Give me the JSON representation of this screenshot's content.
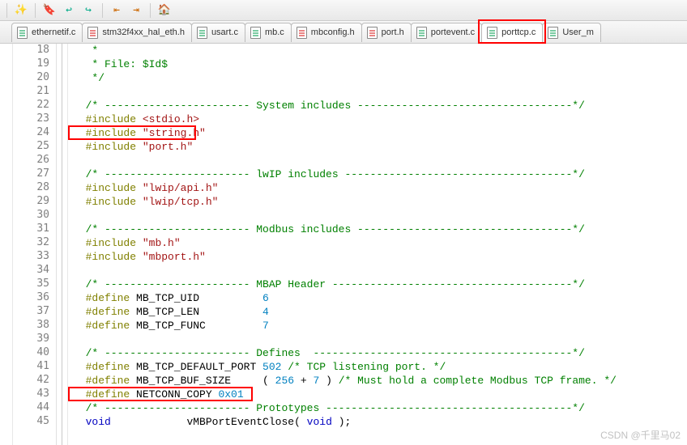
{
  "toolbar_icons": [
    "wand-icon",
    "bookmark-prev-icon",
    "bookmark-next-icon",
    "bookmark-clear-icon",
    "indent-left-icon",
    "indent-right-icon",
    "home-icon"
  ],
  "tabs": [
    {
      "label": "ethernetif.c",
      "type": "c",
      "active": false
    },
    {
      "label": "stm32f4xx_hal_eth.h",
      "type": "h",
      "active": false
    },
    {
      "label": "usart.c",
      "type": "c",
      "active": false
    },
    {
      "label": "mb.c",
      "type": "c",
      "active": false
    },
    {
      "label": "mbconfig.h",
      "type": "h",
      "active": false
    },
    {
      "label": "port.h",
      "type": "h",
      "active": false
    },
    {
      "label": "portevent.c",
      "type": "c",
      "active": false
    },
    {
      "label": "porttcp.c",
      "type": "c",
      "active": true
    },
    {
      "label": "User_m",
      "type": "c",
      "active": false
    }
  ],
  "highlight_tab_index": 7,
  "line_start": 18,
  "line_end": 45,
  "code_lines": [
    {
      "n": 18,
      "tokens": [
        {
          "t": "   *",
          "c": "c-comment"
        }
      ]
    },
    {
      "n": 19,
      "tokens": [
        {
          "t": "   * File: $Id$",
          "c": "c-comment"
        }
      ]
    },
    {
      "n": 20,
      "tokens": [
        {
          "t": "   */",
          "c": "c-comment"
        }
      ]
    },
    {
      "n": 21,
      "tokens": []
    },
    {
      "n": 22,
      "tokens": [
        {
          "t": "  /* ----------------------- System includes ----------------------------------*/",
          "c": "c-comment"
        }
      ]
    },
    {
      "n": 23,
      "tokens": [
        {
          "t": "  ",
          "c": ""
        },
        {
          "t": "#include",
          "c": "c-macro"
        },
        {
          "t": " ",
          "c": ""
        },
        {
          "t": "<stdio.h>",
          "c": "c-string"
        }
      ]
    },
    {
      "n": 24,
      "tokens": [
        {
          "t": "  ",
          "c": ""
        },
        {
          "t": "#include",
          "c": "c-macro"
        },
        {
          "t": " ",
          "c": ""
        },
        {
          "t": "\"string.h\"",
          "c": "c-string"
        }
      ]
    },
    {
      "n": 25,
      "tokens": [
        {
          "t": "  ",
          "c": ""
        },
        {
          "t": "#include",
          "c": "c-macro"
        },
        {
          "t": " ",
          "c": ""
        },
        {
          "t": "\"port.h\"",
          "c": "c-string"
        }
      ]
    },
    {
      "n": 26,
      "tokens": []
    },
    {
      "n": 27,
      "tokens": [
        {
          "t": "  /* ----------------------- lwIP includes ------------------------------------*/",
          "c": "c-comment"
        }
      ]
    },
    {
      "n": 28,
      "tokens": [
        {
          "t": "  ",
          "c": ""
        },
        {
          "t": "#include",
          "c": "c-macro"
        },
        {
          "t": " ",
          "c": ""
        },
        {
          "t": "\"lwip/api.h\"",
          "c": "c-string"
        }
      ]
    },
    {
      "n": 29,
      "tokens": [
        {
          "t": "  ",
          "c": ""
        },
        {
          "t": "#include",
          "c": "c-macro"
        },
        {
          "t": " ",
          "c": ""
        },
        {
          "t": "\"lwip/tcp.h\"",
          "c": "c-string"
        }
      ]
    },
    {
      "n": 30,
      "tokens": []
    },
    {
      "n": 31,
      "tokens": [
        {
          "t": "  /* ----------------------- Modbus includes ----------------------------------*/",
          "c": "c-comment"
        }
      ]
    },
    {
      "n": 32,
      "tokens": [
        {
          "t": "  ",
          "c": ""
        },
        {
          "t": "#include",
          "c": "c-macro"
        },
        {
          "t": " ",
          "c": ""
        },
        {
          "t": "\"mb.h\"",
          "c": "c-string"
        }
      ]
    },
    {
      "n": 33,
      "tokens": [
        {
          "t": "  ",
          "c": ""
        },
        {
          "t": "#include",
          "c": "c-macro"
        },
        {
          "t": " ",
          "c": ""
        },
        {
          "t": "\"mbport.h\"",
          "c": "c-string"
        }
      ]
    },
    {
      "n": 34,
      "tokens": []
    },
    {
      "n": 35,
      "tokens": [
        {
          "t": "  /* ----------------------- MBAP Header --------------------------------------*/",
          "c": "c-comment"
        }
      ]
    },
    {
      "n": 36,
      "tokens": [
        {
          "t": "  ",
          "c": ""
        },
        {
          "t": "#define",
          "c": "c-macro"
        },
        {
          "t": " MB_TCP_UID          ",
          "c": ""
        },
        {
          "t": "6",
          "c": "c-number"
        }
      ]
    },
    {
      "n": 37,
      "tokens": [
        {
          "t": "  ",
          "c": ""
        },
        {
          "t": "#define",
          "c": "c-macro"
        },
        {
          "t": " MB_TCP_LEN          ",
          "c": ""
        },
        {
          "t": "4",
          "c": "c-number"
        }
      ]
    },
    {
      "n": 38,
      "tokens": [
        {
          "t": "  ",
          "c": ""
        },
        {
          "t": "#define",
          "c": "c-macro"
        },
        {
          "t": " MB_TCP_FUNC         ",
          "c": ""
        },
        {
          "t": "7",
          "c": "c-number"
        }
      ]
    },
    {
      "n": 39,
      "tokens": []
    },
    {
      "n": 40,
      "tokens": [
        {
          "t": "  /* ----------------------- Defines  -----------------------------------------*/",
          "c": "c-comment"
        }
      ]
    },
    {
      "n": 41,
      "tokens": [
        {
          "t": "  ",
          "c": ""
        },
        {
          "t": "#define",
          "c": "c-macro"
        },
        {
          "t": " MB_TCP_DEFAULT_PORT ",
          "c": ""
        },
        {
          "t": "502",
          "c": "c-number"
        },
        {
          "t": " /* TCP listening port. */",
          "c": "c-comment"
        }
      ]
    },
    {
      "n": 42,
      "tokens": [
        {
          "t": "  ",
          "c": ""
        },
        {
          "t": "#define",
          "c": "c-macro"
        },
        {
          "t": " MB_TCP_BUF_SIZE     ( ",
          "c": ""
        },
        {
          "t": "256",
          "c": "c-number"
        },
        {
          "t": " + ",
          "c": ""
        },
        {
          "t": "7",
          "c": "c-number"
        },
        {
          "t": " ) ",
          "c": ""
        },
        {
          "t": "/* Must hold a complete Modbus TCP frame. */",
          "c": "c-comment"
        }
      ]
    },
    {
      "n": 43,
      "tokens": [
        {
          "t": "  ",
          "c": ""
        },
        {
          "t": "#define",
          "c": "c-macro"
        },
        {
          "t": " NETCONN_COPY ",
          "c": ""
        },
        {
          "t": "0x01",
          "c": "c-number"
        }
      ]
    },
    {
      "n": 44,
      "tokens": [
        {
          "t": "  /* ----------------------- Prototypes ---------------------------------------*/",
          "c": "c-comment"
        }
      ]
    },
    {
      "n": 45,
      "tokens": [
        {
          "t": "  ",
          "c": ""
        },
        {
          "t": "void",
          "c": "c-type"
        },
        {
          "t": "            vMBPortEventClose( ",
          "c": ""
        },
        {
          "t": "void",
          "c": "c-type"
        },
        {
          "t": " );",
          "c": ""
        }
      ]
    }
  ],
  "highlight_lines": [
    24,
    43
  ],
  "watermark": "CSDN @千里马02"
}
